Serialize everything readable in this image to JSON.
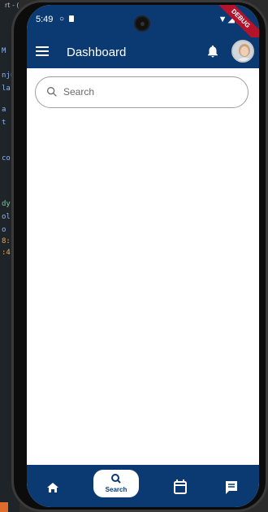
{
  "status_bar": {
    "time": "5:49",
    "debug_label": "DEBUG"
  },
  "app_bar": {
    "title": "Dashboard"
  },
  "search": {
    "placeholder": "Search"
  },
  "bottom_nav": {
    "items": [
      {
        "icon": "home-icon"
      },
      {
        "icon": "search-icon",
        "label": "Search"
      },
      {
        "icon": "calendar-icon"
      },
      {
        "icon": "message-icon"
      }
    ]
  },
  "colors": {
    "primary": "#0b3a73",
    "background": "#ffffff",
    "debug": "#b3132b"
  },
  "background_ide": {
    "caption": "rt - (",
    "fragments": [
      "M",
      "nju",
      "la:",
      "a",
      "t",
      "co",
      "dy",
      "ol",
      "o",
      "8:",
      ":4"
    ]
  }
}
